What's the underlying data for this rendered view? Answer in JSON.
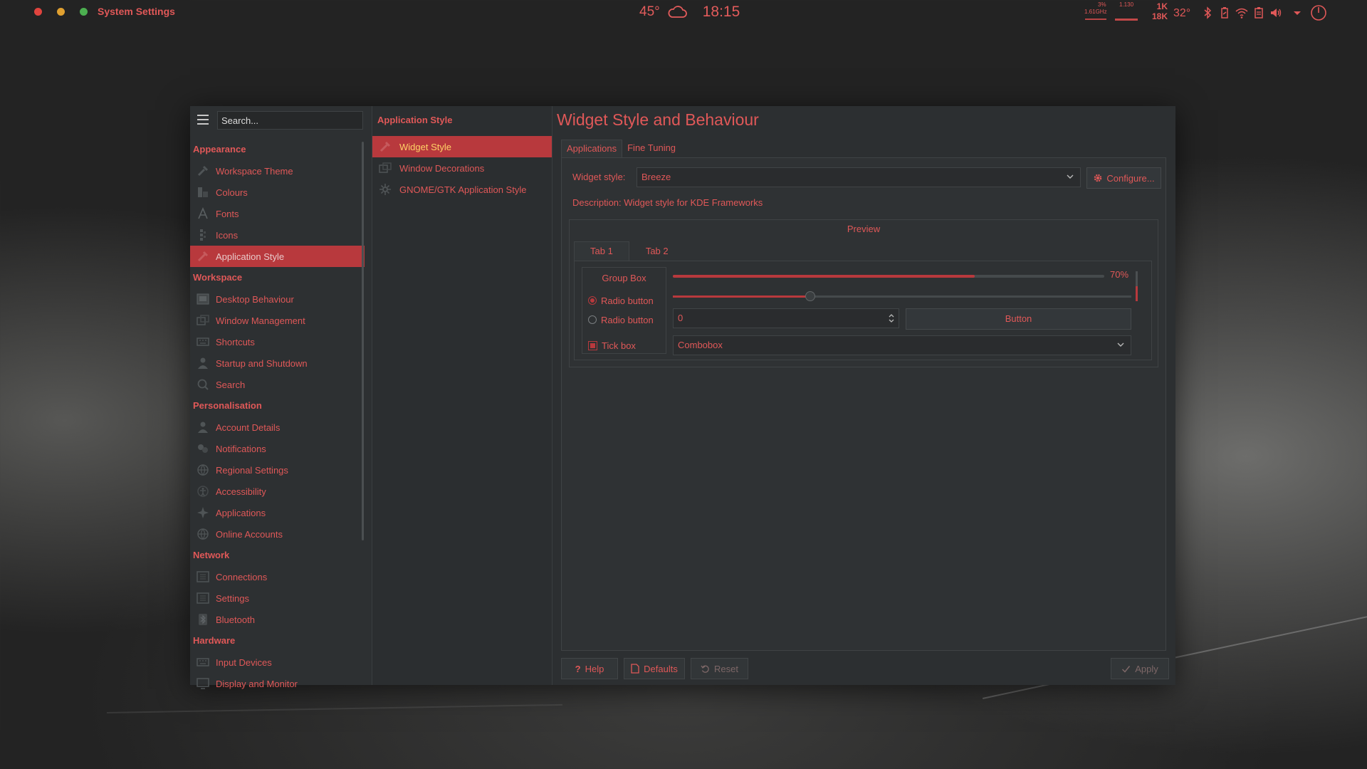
{
  "topbar": {
    "window_title": "System Settings",
    "weather_temp": "45°",
    "weather_icon": "cloud-icon",
    "clock": "18:15",
    "cpu_percent": "3%",
    "cpu_freq": "1.61GHz",
    "mem_value": "1.130",
    "net_up": "1K",
    "net_down": "18K",
    "cpu_temp": "32°",
    "tray_icons": [
      "bluetooth-icon",
      "battery-icon",
      "wifi-icon",
      "clipboard-icon",
      "volume-icon",
      "tray-expand-icon",
      "power-icon"
    ],
    "accent": "#e05858"
  },
  "sidebar": {
    "search_placeholder": "Search...",
    "sections": [
      {
        "title": "Appearance",
        "items": [
          {
            "label": "Workspace Theme",
            "icon": "workspace-theme-icon"
          },
          {
            "label": "Colours",
            "icon": "colours-icon"
          },
          {
            "label": "Fonts",
            "icon": "fonts-icon"
          },
          {
            "label": "Icons",
            "icon": "icons-icon"
          },
          {
            "label": "Application Style",
            "icon": "application-style-icon",
            "active": true
          }
        ]
      },
      {
        "title": "Workspace",
        "items": [
          {
            "label": "Desktop Behaviour",
            "icon": "desktop-behaviour-icon"
          },
          {
            "label": "Window Management",
            "icon": "window-management-icon"
          },
          {
            "label": "Shortcuts",
            "icon": "shortcuts-icon"
          },
          {
            "label": "Startup and Shutdown",
            "icon": "startup-shutdown-icon"
          },
          {
            "label": "Search",
            "icon": "search-icon"
          }
        ]
      },
      {
        "title": "Personalisation",
        "items": [
          {
            "label": "Account Details",
            "icon": "account-details-icon"
          },
          {
            "label": "Notifications",
            "icon": "notifications-icon"
          },
          {
            "label": "Regional Settings",
            "icon": "regional-settings-icon"
          },
          {
            "label": "Accessibility",
            "icon": "accessibility-icon"
          },
          {
            "label": "Applications",
            "icon": "applications-icon"
          },
          {
            "label": "Online Accounts",
            "icon": "online-accounts-icon"
          }
        ]
      },
      {
        "title": "Network",
        "items": [
          {
            "label": "Connections",
            "icon": "connections-icon"
          },
          {
            "label": "Settings",
            "icon": "network-settings-icon"
          },
          {
            "label": "Bluetooth",
            "icon": "bluetooth-icon"
          }
        ]
      },
      {
        "title": "Hardware",
        "items": [
          {
            "label": "Input Devices",
            "icon": "input-devices-icon"
          },
          {
            "label": "Display and Monitor",
            "icon": "display-monitor-icon"
          }
        ]
      }
    ]
  },
  "middle": {
    "title": "Application Style",
    "items": [
      {
        "label": "Widget Style",
        "icon": "widget-style-icon",
        "active": true
      },
      {
        "label": "Window Decorations",
        "icon": "window-decorations-icon"
      },
      {
        "label": "GNOME/GTK Application Style",
        "icon": "gtk-style-icon"
      }
    ]
  },
  "content": {
    "title": "Widget Style and Behaviour",
    "tabs": [
      "Applications",
      "Fine Tuning"
    ],
    "widget_style_label": "Widget style:",
    "widget_style_value": "Breeze",
    "configure_label": "Configure...",
    "description": "Description: Widget style for KDE Frameworks",
    "preview": {
      "label": "Preview",
      "tabs": [
        "Tab 1",
        "Tab 2"
      ],
      "group_box_title": "Group Box",
      "radio1_label": "Radio button",
      "radio1_checked": true,
      "radio2_label": "Radio button",
      "radio2_checked": false,
      "tickbox_label": "Tick box",
      "tickbox_checked": true,
      "progress_percent": 70,
      "progress_text": "70%",
      "slider_fraction": 0.3,
      "vertical_fraction": 0.5,
      "spinbox_value": "0",
      "button_label": "Button",
      "combobox_value": "Combobox"
    }
  },
  "footer": {
    "help": "Help",
    "defaults": "Defaults",
    "reset": "Reset",
    "apply": "Apply"
  }
}
